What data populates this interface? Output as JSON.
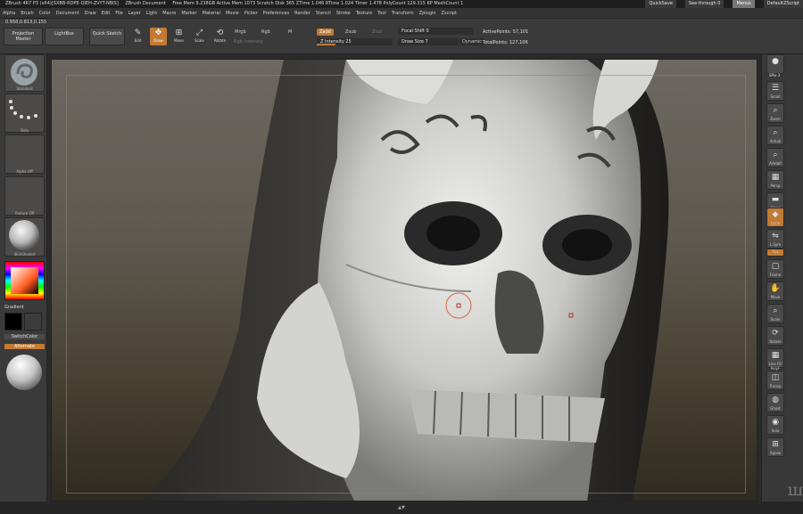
{
  "titlebar": {
    "app_title": "ZBrush 4R7 P3 (x64)[SXBB-RDPE-QIEH-ZVYT-NBIS]",
    "document": "ZBrush Document",
    "stats": "Free Mem 9.238GB  Active Mem 1073  Scratch Disk 365  ZTime 1.046 RTime 1.024  Timer 1.478  PolyCount 129.315 KP  MeshCount 1",
    "quicksave": "QuickSave",
    "seethrough": "See-through  0",
    "menus": "Menus",
    "defaultscript": "DefaultZScript"
  },
  "menubar": {
    "items": [
      "Alpha",
      "Brush",
      "Color",
      "Document",
      "Draw",
      "Edit",
      "File",
      "Layer",
      "Light",
      "Macro",
      "Marker",
      "Material",
      "Movie",
      "Picker",
      "Preferences",
      "Render",
      "Stencil",
      "Stroke",
      "Texture",
      "Tool",
      "Transform",
      "Zplugin",
      "Zscript"
    ]
  },
  "shelf": {
    "coords": "0.958,0.813,0.155",
    "projection_master": "Projection Master",
    "lightbox": "LightBox",
    "quick_sketch": "Quick Sketch",
    "edit": "Edit",
    "draw": "Draw",
    "move": "Move",
    "scale": "Scale",
    "rotate": "Rotate",
    "mrgb": "Mrgb",
    "rgb": "Rgb",
    "m": "M",
    "rgb_intensity": "Rgb Intensity",
    "zadd": "Zadd",
    "zsub": "Zsub",
    "zcut": "Zcut",
    "z_intensity": "Z Intensity 25",
    "z_intensity_value": 0.25,
    "focal_shift": "Focal Shift 0",
    "draw_size": "Draw Size 7",
    "dynamic": "Dynamic",
    "active_points": "ActivePoints: 57,101",
    "total_points": "TotalPoints: 127,106"
  },
  "leftpanel": {
    "brush_label": "Standard",
    "stroke_label": "Dots",
    "alpha_label": "Alpha Off",
    "texture_label": "Texture Off",
    "material_label": "SkinShade4",
    "gradient_label": "Gradient",
    "switchcolor_label": "SwitchColor",
    "alternate_label": "Alternate"
  },
  "rightpanel": {
    "buttons": [
      "SPix 3",
      "Scroll",
      "Zoom",
      "Actual",
      "AAHalf",
      "Persp",
      "Floor",
      "Local",
      "L.Sym",
      "Frame",
      "Move",
      "Scale",
      "Rotate",
      "Line Fill PolyF",
      "Transp",
      "Ghost",
      "Solo",
      "Xpose"
    ],
    "xyz_label": "Xyz"
  },
  "colors": {
    "accent": "#c27a34",
    "panel": "#3a3a3a",
    "primary_color": "#000000",
    "secondary_color": "#3c3c3c"
  },
  "bottombar": {
    "arrow": "▲▼"
  }
}
